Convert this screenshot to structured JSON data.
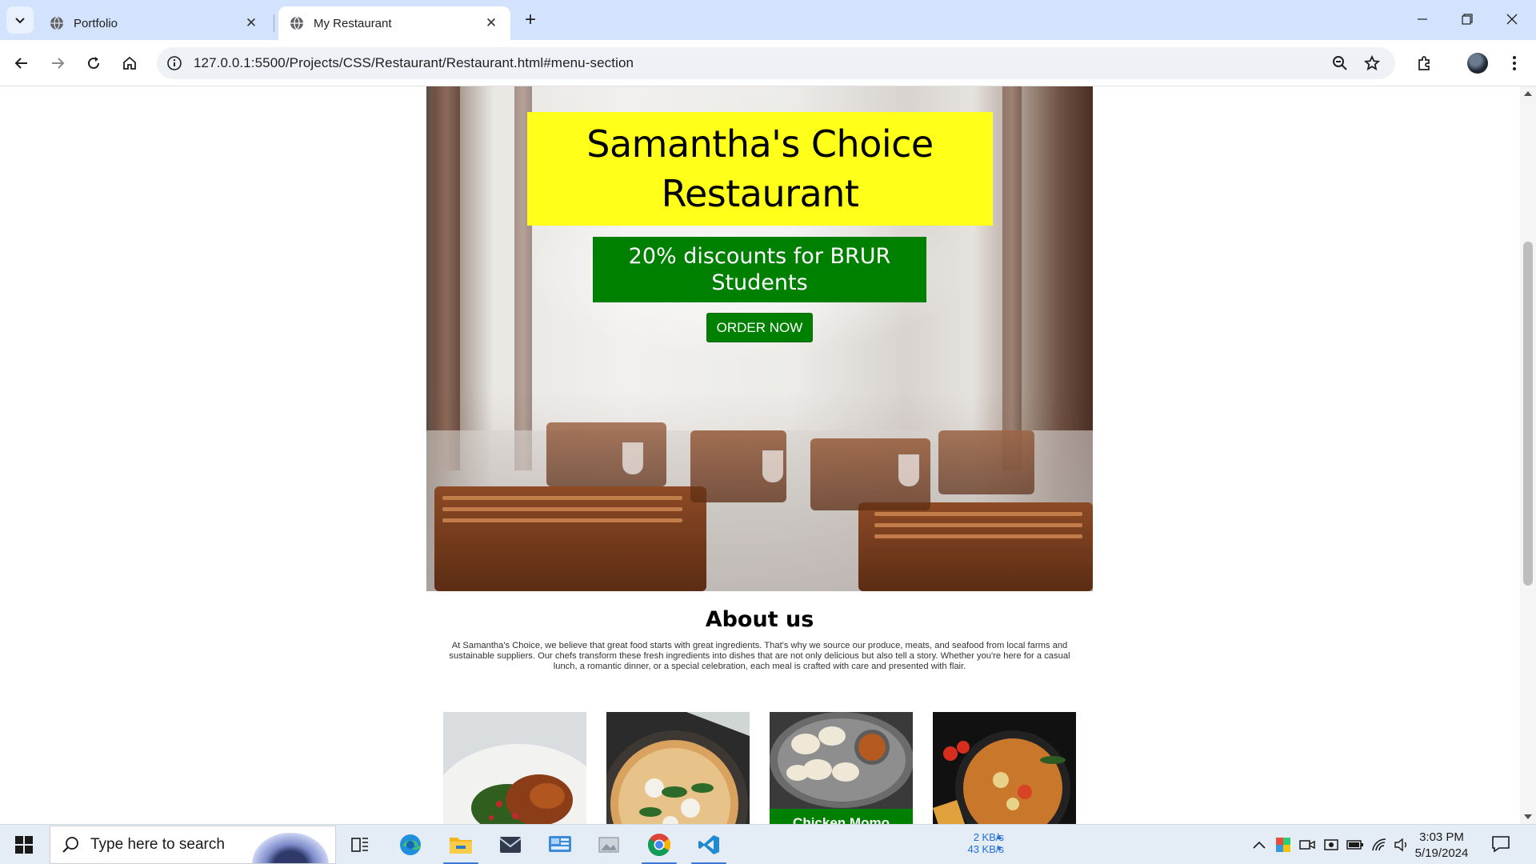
{
  "browser": {
    "tabs": [
      {
        "title": "Portfolio",
        "active": false
      },
      {
        "title": "My Restaurant",
        "active": true
      }
    ],
    "new_tab_label": "+",
    "url": "127.0.0.1:5500/Projects/CSS/Restaurant/Restaurant.html#menu-section"
  },
  "page": {
    "hero": {
      "title": "Samantha's Choice Restaurant",
      "discount": "20% discounts for BRUR Students",
      "order_button": "ORDER NOW"
    },
    "about": {
      "title": "About us",
      "text": "At Samantha's Choice, we believe that great food starts with great ingredients. That's why we source our produce, meats, and seafood from local farms and sustainable suppliers. Our chefs transform these fresh ingredients into dishes that are not only delicious but also tell a story. Whether you're here for a casual lunch, a romantic dinner, or a special celebration, each meal is crafted with care and presented with flair."
    },
    "menu_cards": [
      {
        "label": ""
      },
      {
        "label": ""
      },
      {
        "label": "Chicken Momo"
      },
      {
        "label": ""
      }
    ]
  },
  "taskbar": {
    "search_placeholder": "Type here to search",
    "net_up": "2 KB/s",
    "net_down": "43 KB/s",
    "time": "3:03 PM",
    "date": "5/19/2024"
  },
  "colors": {
    "title_bg": "#ffff19",
    "discount_bg": "#008000",
    "button_bg": "#008000",
    "tabstrip_bg": "#d3e3fd"
  }
}
